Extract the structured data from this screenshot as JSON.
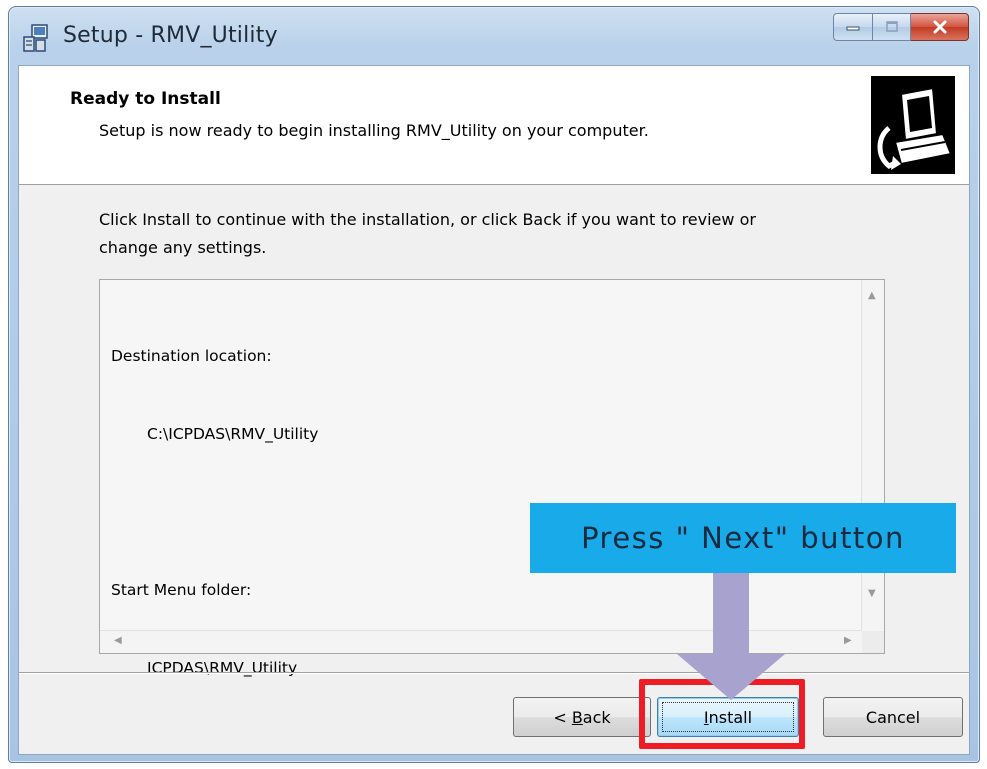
{
  "window": {
    "title": "Setup - RMV_Utility",
    "app_icon": "setup-icon",
    "controls": {
      "minimize_icon": "minimize-icon",
      "maximize_icon": "maximize-icon",
      "close_icon": "close-icon"
    }
  },
  "header": {
    "title": "Ready to Install",
    "subtitle": "Setup is now ready to begin installing RMV_Utility on your computer.",
    "icon": "computer-install-icon"
  },
  "body": {
    "description_line1": "Click Install to continue with the installation, or click Back if you want to review or",
    "description_line2": "change any settings.",
    "memo": {
      "destination_label": "Destination location:",
      "destination_value": "C:\\ICPDAS\\RMV_Utility",
      "start_menu_label": "Start Menu folder:",
      "start_menu_value": "ICPDAS\\RMV_Utility"
    }
  },
  "buttons": {
    "back_prefix": "< ",
    "back_mnemonic": "B",
    "back_rest": "ack",
    "install_mnemonic": "I",
    "install_rest": "nstall",
    "cancel": "Cancel"
  },
  "annotation": {
    "callout_text": "Press \" Next\"  button",
    "callout_color": "#19aaea",
    "arrow_color": "#a8a2cf",
    "highlight_color": "#ee1c24"
  }
}
